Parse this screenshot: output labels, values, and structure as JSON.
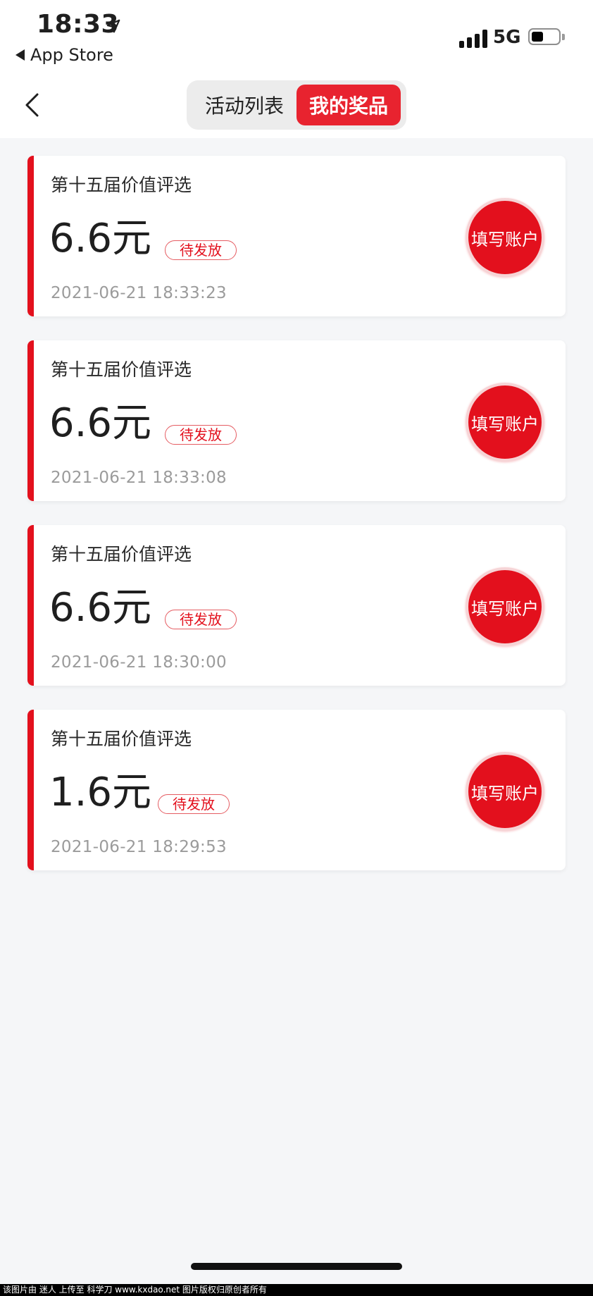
{
  "status_bar": {
    "time": "18:33",
    "back_app": "App Store",
    "network": "5G",
    "battery_level": 0.45
  },
  "header": {
    "tabs": [
      {
        "label": "活动列表",
        "active": false
      },
      {
        "label": "我的奖品",
        "active": true
      }
    ]
  },
  "colors": {
    "accent": "#e3101d",
    "tab_active_bg": "#e8232f",
    "background": "#f5f6f8",
    "muted_text": "#9b9b9b"
  },
  "prizes": [
    {
      "title": "第十五届价值评选",
      "amount": "6.6元",
      "status": "待发放",
      "time": "2021-06-21 18:33:23",
      "action": "填写账户"
    },
    {
      "title": "第十五届价值评选",
      "amount": "6.6元",
      "status": "待发放",
      "time": "2021-06-21 18:33:08",
      "action": "填写账户"
    },
    {
      "title": "第十五届价值评选",
      "amount": "6.6元",
      "status": "待发放",
      "time": "2021-06-21 18:30:00",
      "action": "填写账户"
    },
    {
      "title": "第十五届价值评选",
      "amount": "1.6元",
      "status": "待发放",
      "time": "2021-06-21 18:29:53",
      "action": "填写账户"
    }
  ],
  "footer": {
    "watermark": "该图片由 迷人 上传至 科学刀 www.kxdao.net 图片版权归原创者所有"
  }
}
